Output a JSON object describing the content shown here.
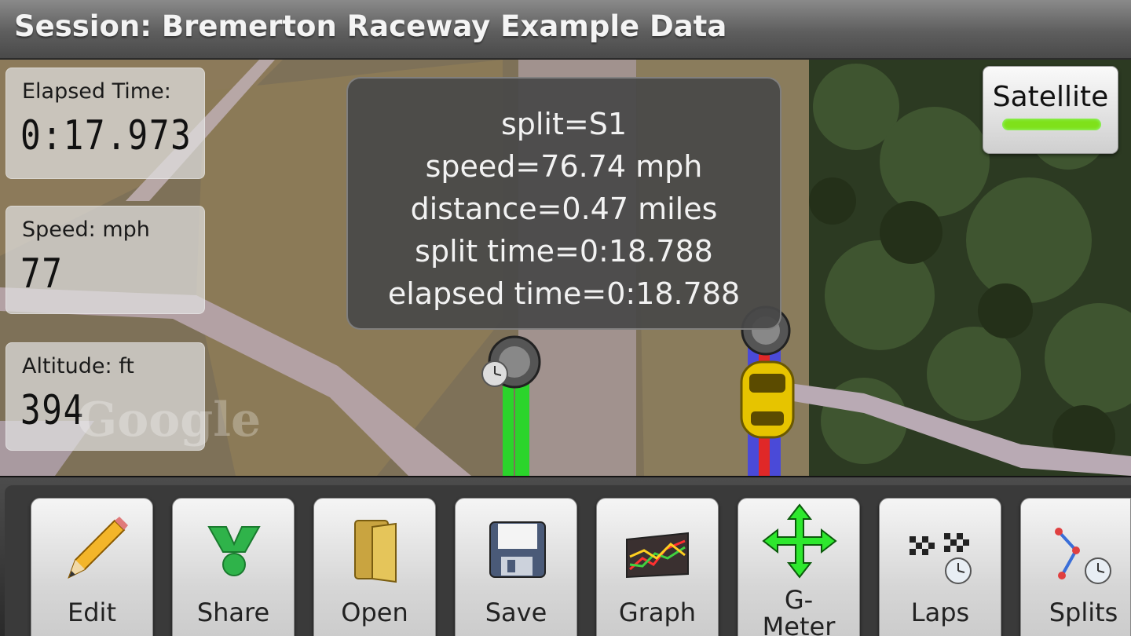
{
  "session": {
    "title": "Session: Bremerton Raceway Example Data"
  },
  "stats": {
    "elapsed": {
      "label": "Elapsed Time:",
      "value": "0:17.973"
    },
    "speed": {
      "label": "Speed: mph",
      "value": "77"
    },
    "altitude": {
      "label": "Altitude: ft",
      "value": "394"
    }
  },
  "map": {
    "watermark": "Google"
  },
  "tooltip": {
    "lines": [
      "split=S1",
      "speed=76.74 mph",
      "distance=0.47 miles",
      "split time=0:18.788",
      "elapsed time=0:18.788"
    ]
  },
  "map_type": {
    "label": "Satellite",
    "indicator_color": "#7fe11a"
  },
  "toolbar": {
    "edit": "Edit",
    "share": "Share",
    "open": "Open",
    "save": "Save",
    "graph": "Graph",
    "gmeter_line1": "G-",
    "gmeter_line2": "Meter",
    "laps": "Laps",
    "splits": "Splits"
  },
  "colors": {
    "track_green": "#2bd42b",
    "track_blue": "#4a4ad8",
    "track_red": "#e02828",
    "car": "#e6c400"
  },
  "icons": [
    "pencil-icon",
    "share-icon",
    "folder-icon",
    "floppy-disk-icon",
    "graph-icon",
    "move-arrows-icon",
    "checkered-flags-icon",
    "splits-icon",
    "timer-icon",
    "car-icon"
  ]
}
